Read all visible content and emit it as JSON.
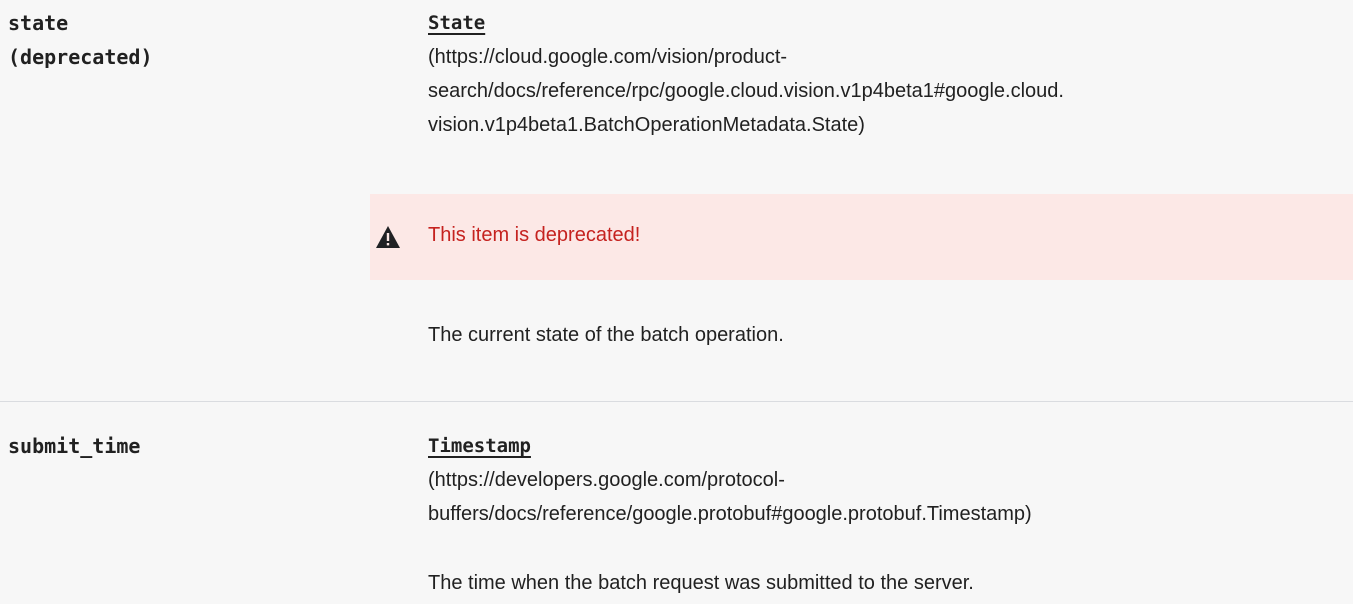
{
  "fields": [
    {
      "name_lines": [
        "state",
        "(deprecated)"
      ],
      "type_label": "State",
      "type_url_lines": [
        " (https://cloud.google.com/vision/product-",
        "search/docs/reference/rpc/google.cloud.vision.v1p4beta1#google.cloud.",
        "vision.v1p4beta1.BatchOperationMetadata.State)"
      ],
      "deprecation_notice": "This item is deprecated!",
      "description": "The current state of the batch operation."
    },
    {
      "name_lines": [
        "submit_time"
      ],
      "type_label": "Timestamp",
      "type_url_lines": [
        " (https://developers.google.com/protocol-",
        "buffers/docs/reference/google.protobuf#google.protobuf.Timestamp)"
      ],
      "description": "The time when the batch request was submitted to the server."
    }
  ],
  "colors": {
    "row_background": "#f7f7f7",
    "deprecated_background": "#fce8e6",
    "deprecated_text": "#c5221f",
    "text": "#212121",
    "divider": "#dadce0"
  },
  "icons": {
    "deprecation": "warning-icon"
  }
}
